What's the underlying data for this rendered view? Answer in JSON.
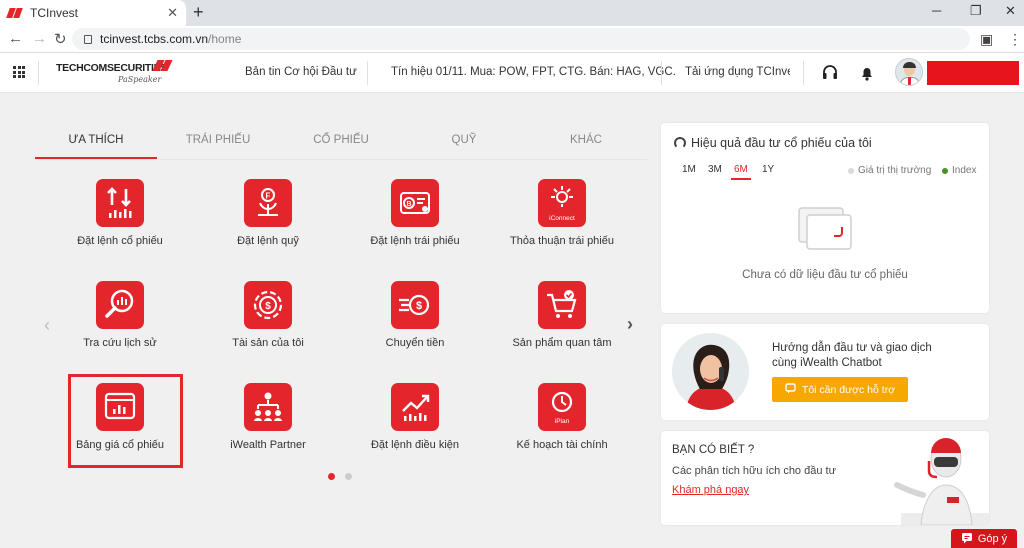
{
  "browser": {
    "tab_title": "TCInvest",
    "tab_close": "✕",
    "new_tab": "+",
    "url_host": "tcinvest.tcbs.com.vn",
    "url_path": "/home"
  },
  "header": {
    "logo_text": "TECHCOMSECURITIES",
    "logo_signature": "PaSpeaker",
    "news": "Bản tin Cơ hội Đầu tư",
    "signal": "Tín hiệu 01/11. Mua: POW, FPT, CTG. Bán: HAG, VGC.",
    "download": "Tải ứng dụng TCInvest"
  },
  "category_tabs": [
    {
      "label": "ƯA THÍCH",
      "active": true
    },
    {
      "label": "TRÁI PHIẾU",
      "active": false
    },
    {
      "label": "CỔ PHIẾU",
      "active": false
    },
    {
      "label": "QUỸ",
      "active": false
    },
    {
      "label": "KHÁC",
      "active": false
    }
  ],
  "tiles": [
    {
      "label": "Đặt lệnh cổ phiếu",
      "icon": "stock-order-icon"
    },
    {
      "label": "Đặt lệnh quỹ",
      "icon": "fund-order-icon"
    },
    {
      "label": "Đặt lệnh trái phiếu",
      "icon": "bond-order-icon"
    },
    {
      "label": "Thỏa thuận trái phiếu",
      "icon": "iconnect-icon",
      "icon_text": "iConnect"
    },
    {
      "label": "Tra cứu lịch sử",
      "icon": "history-search-icon"
    },
    {
      "label": "Tài sản của tôi",
      "icon": "my-assets-icon"
    },
    {
      "label": "Chuyển tiền",
      "icon": "money-transfer-icon"
    },
    {
      "label": "Sản phẩm quan tâm",
      "icon": "cart-icon"
    },
    {
      "label": "Bảng giá cổ phiếu",
      "icon": "price-board-icon"
    },
    {
      "label": "iWealth Partner",
      "icon": "partner-icon"
    },
    {
      "label": "Đặt lệnh điều kiện",
      "icon": "conditional-order-icon"
    },
    {
      "label": "Kế hoạch tài chính",
      "icon": "iplan-icon",
      "icon_text": "iPlan"
    }
  ],
  "pagination": {
    "pages": 2,
    "current": 1
  },
  "performance": {
    "title": "Hiệu quả đầu tư cổ phiếu của tôi",
    "periods": [
      {
        "label": "1M",
        "active": false
      },
      {
        "label": "3M",
        "active": false
      },
      {
        "label": "6M",
        "active": true
      },
      {
        "label": "1Y",
        "active": false
      }
    ],
    "legend_market": "Giá trị thị trường",
    "legend_index": "Index",
    "market_color": "#d9d9d9",
    "index_color": "#4a8f2a",
    "empty": "Chưa có dữ liệu đầu tư cổ phiếu"
  },
  "chatbot": {
    "line1": "Hướng dẫn đầu tư và giao dịch",
    "line2": "cùng iWealth Chatbot",
    "button": "Tôi cần được hỗ trợ"
  },
  "did_you_know": {
    "heading": "BẠN CÓ BIẾT ?",
    "text": "Các phân tích hữu ích cho đầu tư",
    "link": "Khám phá ngay"
  },
  "feedback": "Góp ý",
  "colors": {
    "brand_red": "#e3262b",
    "button_orange": "#f6a800"
  }
}
